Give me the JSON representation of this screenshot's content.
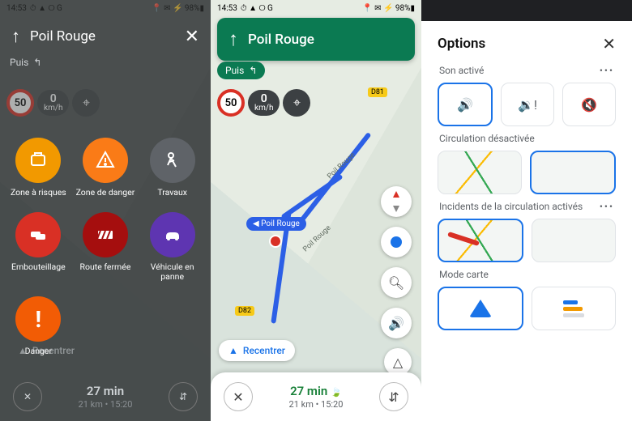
{
  "status": {
    "time": "14:53",
    "icons": "⏱ ▲ ⭘ G",
    "right": "📍 ✉ ⚡ 98%▮"
  },
  "nav": {
    "destination": "Poil Rouge",
    "puis_label": "Puis",
    "speed_limit": "50",
    "speed_value": "0",
    "speed_unit": "km/h",
    "recenter": "Recentrer",
    "eta_duration": "27 min",
    "eta_sub": "21 km  •  15:20",
    "chip": "Poil Rouge",
    "roadA": "D81",
    "roadB": "D82",
    "roadname": "Poil Rouge"
  },
  "hazards": {
    "close": "✕",
    "items": [
      {
        "label": "Zone à risques"
      },
      {
        "label": "Zone de danger"
      },
      {
        "label": "Travaux"
      },
      {
        "label": "Embouteillage"
      },
      {
        "label": "Route fermée"
      },
      {
        "label": "Véhicule en panne"
      },
      {
        "label": "Danger"
      }
    ]
  },
  "options": {
    "title": "Options",
    "sound": "Son activé",
    "traffic": "Circulation désactivée",
    "incidents": "Incidents de la circulation activés",
    "mapmode": "Mode carte"
  }
}
